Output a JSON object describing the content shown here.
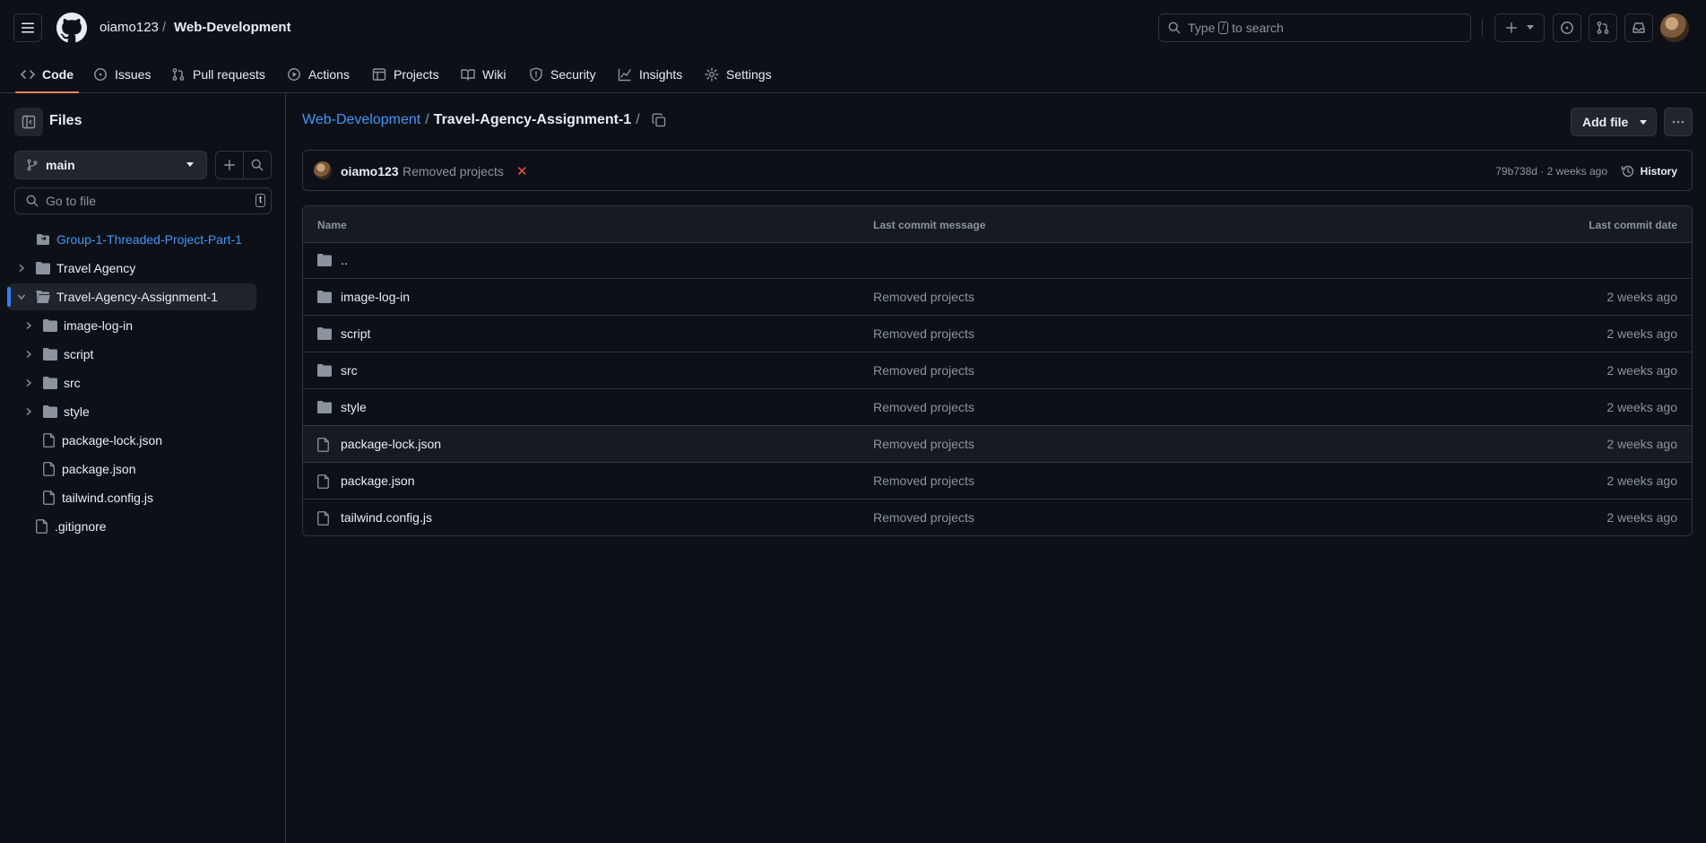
{
  "header": {
    "owner": "oiamo123",
    "separator": "/",
    "repo": "Web-Development",
    "search_prefix": "Type",
    "search_key": "/",
    "search_suffix": "to search"
  },
  "tabs": [
    {
      "label": "Code",
      "icon": "code-icon"
    },
    {
      "label": "Issues",
      "icon": "issue-icon"
    },
    {
      "label": "Pull requests",
      "icon": "pull-request-icon"
    },
    {
      "label": "Actions",
      "icon": "play-icon"
    },
    {
      "label": "Projects",
      "icon": "table-icon"
    },
    {
      "label": "Wiki",
      "icon": "book-icon"
    },
    {
      "label": "Security",
      "icon": "shield-icon"
    },
    {
      "label": "Insights",
      "icon": "graph-icon"
    },
    {
      "label": "Settings",
      "icon": "gear-icon"
    }
  ],
  "sidebar": {
    "title": "Files",
    "branch": "main",
    "goto_placeholder": "Go to file",
    "goto_key": "t",
    "tree": [
      {
        "label": "Group-1-Threaded-Project-Part-1",
        "type": "submodule"
      },
      {
        "label": "Travel Agency",
        "type": "folder"
      },
      {
        "label": "Travel-Agency-Assignment-1",
        "type": "folder-open",
        "selected": true
      },
      {
        "label": "image-log-in",
        "type": "folder"
      },
      {
        "label": "script",
        "type": "folder"
      },
      {
        "label": "src",
        "type": "folder"
      },
      {
        "label": "style",
        "type": "folder"
      },
      {
        "label": "package-lock.json",
        "type": "file"
      },
      {
        "label": "package.json",
        "type": "file"
      },
      {
        "label": "tailwind.config.js",
        "type": "file"
      },
      {
        "label": ".gitignore",
        "type": "file"
      }
    ]
  },
  "main": {
    "crumb_repo": "Web-Development",
    "crumb_sep": "/",
    "crumb_folder": "Travel-Agency-Assignment-1",
    "crumb_trail": "/",
    "add_file": "Add file",
    "commit": {
      "author": "oiamo123",
      "message": "Removed projects",
      "status": "✕",
      "sha_time": "79b738d · 2 weeks ago",
      "history": "History"
    },
    "columns": {
      "name": "Name",
      "message": "Last commit message",
      "date": "Last commit date"
    },
    "rows": [
      {
        "name": "..",
        "type": "folder",
        "message": "",
        "date": ""
      },
      {
        "name": "image-log-in",
        "type": "folder",
        "message": "Removed projects",
        "date": "2 weeks ago"
      },
      {
        "name": "script",
        "type": "folder",
        "message": "Removed projects",
        "date": "2 weeks ago"
      },
      {
        "name": "src",
        "type": "folder",
        "message": "Removed projects",
        "date": "2 weeks ago"
      },
      {
        "name": "style",
        "type": "folder",
        "message": "Removed projects",
        "date": "2 weeks ago"
      },
      {
        "name": "package-lock.json",
        "type": "file",
        "message": "Removed projects",
        "date": "2 weeks ago"
      },
      {
        "name": "package.json",
        "type": "file",
        "message": "Removed projects",
        "date": "2 weeks ago"
      },
      {
        "name": "tailwind.config.js",
        "type": "file",
        "message": "Removed projects",
        "date": "2 weeks ago"
      }
    ]
  },
  "colors": {
    "background": "#0d1117",
    "border": "#30363d",
    "link": "#4493f8",
    "accent_tab": "#f78166",
    "error": "#f85149"
  }
}
